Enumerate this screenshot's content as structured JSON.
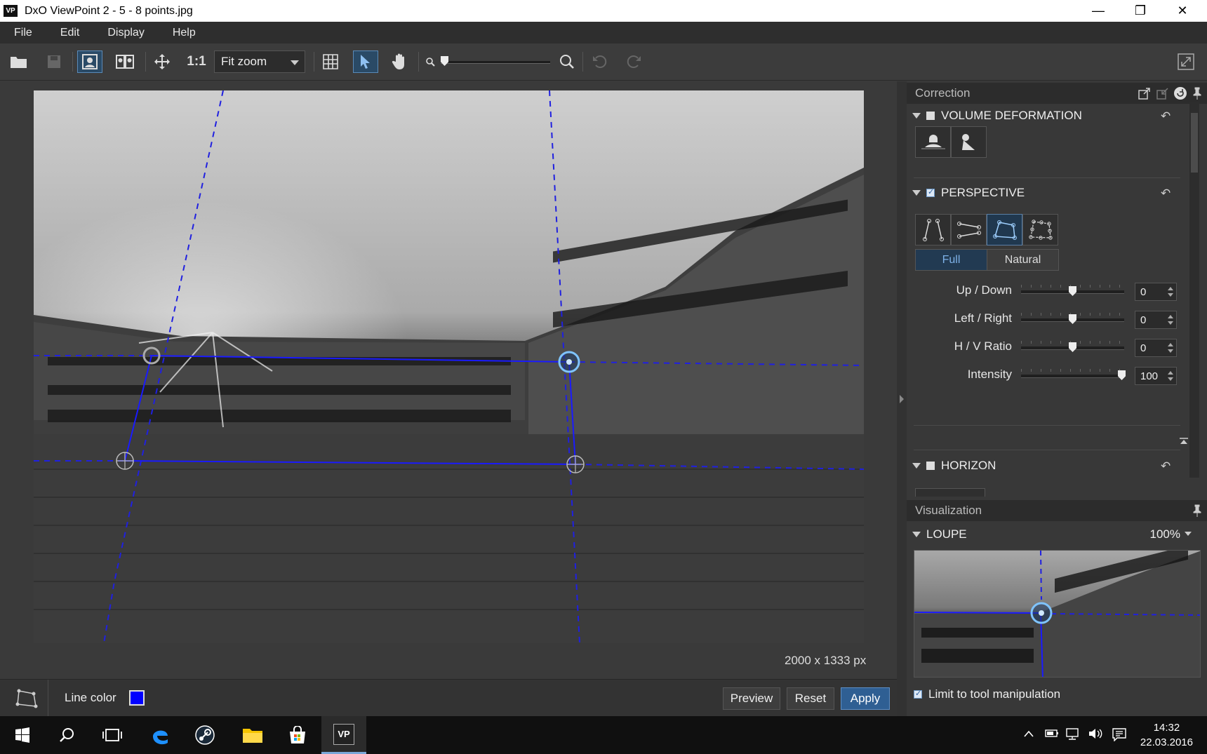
{
  "window": {
    "app_icon": "VP",
    "title": "DxO ViewPoint 2 - 5 - 8 points.jpg",
    "minimize": "—",
    "maximize": "❐",
    "close": "✕"
  },
  "menu": [
    "File",
    "Edit",
    "Display",
    "Help"
  ],
  "toolbar": {
    "one_to_one": "1:1",
    "zoom_select": "Fit zoom",
    "icons": [
      "open-icon",
      "save-icon",
      "single-view-icon",
      "compare-view-icon",
      "move-icon",
      "grid-icon",
      "select-arrow-icon",
      "hand-icon",
      "zoom-out-icon",
      "zoom-in-icon",
      "undo-icon",
      "redo-icon",
      "fullscreen-icon"
    ]
  },
  "canvas": {
    "image_size": "2000 x 1333 px"
  },
  "bottom": {
    "line_color_label": "Line color",
    "line_color": "#0000ff",
    "preview": "Preview",
    "reset": "Reset",
    "apply": "Apply"
  },
  "correction": {
    "header": "Correction",
    "volume_deformation": {
      "title": "VOLUME DEFORMATION",
      "enabled": false
    },
    "perspective": {
      "title": "PERSPECTIVE",
      "enabled": true,
      "modes": [
        "Full",
        "Natural"
      ],
      "selected_mode": "Full",
      "sliders": [
        {
          "label": "Up  /  Down",
          "value": "0",
          "position": 0.5
        },
        {
          "label": "Left  /  Right",
          "value": "0",
          "position": 0.5
        },
        {
          "label": "H  /  V Ratio",
          "value": "0",
          "position": 0.5
        },
        {
          "label": "Intensity",
          "value": "100",
          "position": 1.0
        }
      ]
    },
    "horizon": {
      "title": "HORIZON",
      "enabled": false
    }
  },
  "visualization": {
    "header": "Visualization",
    "loupe_title": "LOUPE",
    "loupe_zoom": "100%",
    "limit_label": "Limit to tool manipulation",
    "limit_checked": true
  },
  "taskbar": {
    "time": "14:32",
    "date": "22.03.2016",
    "vp_label": "VP"
  }
}
